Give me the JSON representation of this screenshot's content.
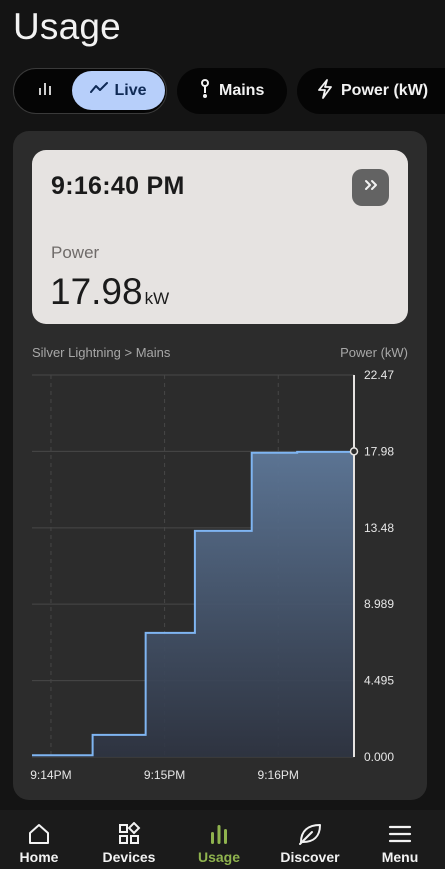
{
  "header": {
    "title": "Usage"
  },
  "filters": {
    "view_bar_icon": "bar-chart-icon",
    "live": {
      "label": "Live",
      "icon": "trend-line-icon",
      "selected": true
    },
    "circuit": {
      "label": "Mains",
      "icon": "probe-icon"
    },
    "metric": {
      "label": "Power (kW)",
      "icon": "lightning-icon"
    }
  },
  "card": {
    "time": "9:16:40 PM",
    "label": "Power",
    "value": "17.98",
    "unit": "kW",
    "expand_icon": "double-chevron-right-icon"
  },
  "chart_header": {
    "title": "Silver Lightning > Mains",
    "unit_label": "Power (kW)"
  },
  "chart_data": {
    "type": "area",
    "step": true,
    "x_ticks": [
      "9:14PM",
      "9:15PM",
      "9:16PM"
    ],
    "y_ticks": [
      "22.47",
      "17.98",
      "13.48",
      "8.989",
      "4.495",
      "0.000"
    ],
    "ylim": [
      0,
      22.47
    ],
    "time_range": [
      "9:13:50 PM",
      "9:16:40 PM"
    ],
    "series": [
      {
        "x": [
          "9:13:50 PM",
          "9:14:22 PM",
          "9:14:50 PM",
          "9:15:16 PM",
          "9:15:46 PM",
          "9:16:10 PM",
          "9:16:40 PM"
        ],
        "values": [
          0.1,
          1.3,
          7.3,
          13.3,
          17.9,
          17.95,
          17.98
        ]
      }
    ],
    "grid": true,
    "colors": {
      "line": "#7fb5f2",
      "fill_top": "#5e7899",
      "fill_bottom": "#2e3442",
      "grid": "#474747",
      "marker": "#e6e3e1"
    }
  },
  "nav": {
    "items": [
      {
        "label": "Home",
        "icon": "home-icon"
      },
      {
        "label": "Devices",
        "icon": "devices-icon"
      },
      {
        "label": "Usage",
        "icon": "usage-bars-icon",
        "active": true
      },
      {
        "label": "Discover",
        "icon": "leaf-icon"
      },
      {
        "label": "Menu",
        "icon": "hamburger-menu-icon"
      }
    ],
    "active_color": "#8fb34e"
  }
}
